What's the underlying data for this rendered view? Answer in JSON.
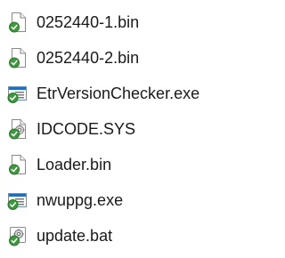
{
  "files": [
    {
      "name": "0252440-1.bin",
      "icon": "generic-file-icon"
    },
    {
      "name": "0252440-2.bin",
      "icon": "generic-file-icon"
    },
    {
      "name": "EtrVersionChecker.exe",
      "icon": "application-icon"
    },
    {
      "name": "IDCODE.SYS",
      "icon": "system-file-icon"
    },
    {
      "name": "Loader.bin",
      "icon": "generic-file-icon"
    },
    {
      "name": "nwuppg.exe",
      "icon": "application-icon"
    },
    {
      "name": "update.bat",
      "icon": "batch-file-icon"
    }
  ],
  "colors": {
    "text": "#1a1a1a",
    "page": "#ffffff",
    "accent_green": "#3c9a3c",
    "app_blue": "#1e6fc0"
  }
}
